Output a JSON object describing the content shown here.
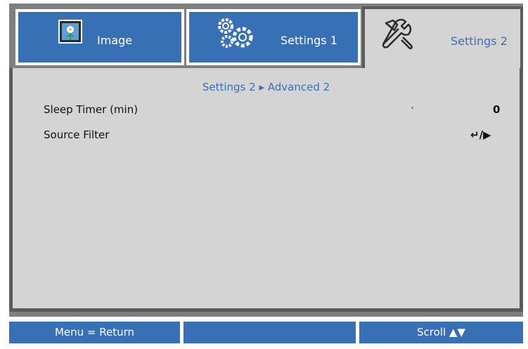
{
  "tabs": [
    {
      "label": "Image",
      "icon": "image-icon"
    },
    {
      "label": "Settings 1",
      "icon": "gears-icon"
    },
    {
      "label": "Settings 2",
      "icon": "tools-icon"
    }
  ],
  "breadcrumb": "Settings 2 ▸ Advanced 2",
  "rows": [
    {
      "label": "Sleep Timer (min)",
      "value": "0",
      "marker": "·"
    },
    {
      "label": "Source Filter",
      "value": "↵/▶"
    }
  ],
  "footer": {
    "left": "Menu = Return",
    "middle": "",
    "right": "Scroll ▲▼"
  },
  "colors": {
    "accent_blue": "#3870b5",
    "panel_gray": "#d4d4d4",
    "frame_gray": "#7f7f7f"
  }
}
